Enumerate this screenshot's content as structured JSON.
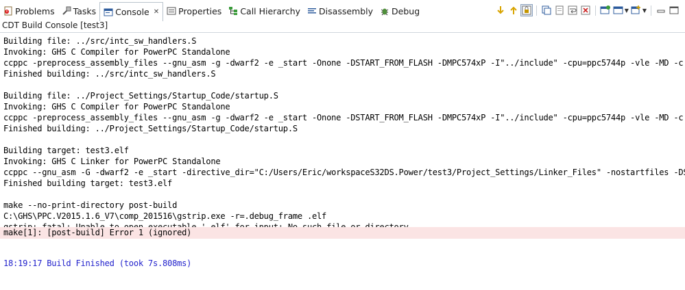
{
  "tabs": [
    {
      "id": "problems",
      "label": "Problems",
      "icon": "problems-icon",
      "active": false
    },
    {
      "id": "tasks",
      "label": "Tasks",
      "icon": "tasks-icon",
      "active": false
    },
    {
      "id": "console",
      "label": "Console",
      "icon": "console-icon",
      "active": true,
      "close": "✕"
    },
    {
      "id": "properties",
      "label": "Properties",
      "icon": "properties-icon",
      "active": false
    },
    {
      "id": "call-hierarchy",
      "label": "Call Hierarchy",
      "icon": "call-hierarchy-icon",
      "active": false
    },
    {
      "id": "disassembly",
      "label": "Disassembly",
      "icon": "disassembly-icon",
      "active": false
    },
    {
      "id": "debug",
      "label": "Debug",
      "icon": "debug-icon",
      "active": false
    }
  ],
  "toolbar_icons": [
    "scroll-down-icon",
    "scroll-up-icon",
    "scroll-lock-icon",
    "copy-icon",
    "clear-icon",
    "word-wrap-icon",
    "remove-icon",
    "pin-console-icon",
    "display-console-icon",
    "open-console-icon",
    "minimize-icon",
    "maximize-icon"
  ],
  "console_title": "CDT Build Console [test3]",
  "console_lines": [
    "Building file: ../src/intc_sw_handlers.S",
    "Invoking: GHS C Compiler for PowerPC Standalone",
    "ccppc -preprocess_assembly_files --gnu_asm -g -dwarf2 -e _start -Onone -DSTART_FROM_FLASH -DMPC574xP -I\"../include\" -cpu=ppc5744p -vle -MD -c -o",
    "Finished building: ../src/intc_sw_handlers.S",
    "",
    "Building file: ../Project_Settings/Startup_Code/startup.S",
    "Invoking: GHS C Compiler for PowerPC Standalone",
    "ccppc -preprocess_assembly_files --gnu_asm -g -dwarf2 -e _start -Onone -DSTART_FROM_FLASH -DMPC574xP -I\"../include\" -cpu=ppc5744p -vle -MD -c -o",
    "Finished building: ../Project_Settings/Startup_Code/startup.S",
    "",
    "Building target: test3.elf",
    "Invoking: GHS C Linker for PowerPC Standalone",
    "ccppc --gnu_asm -G -dwarf2 -e _start -directive_dir=\"C:/Users/Eric/workspaceS32DS.Power/test3/Project_Settings/Linker_Files\" -nostartfiles -DSTA",
    "Finished building target: test3.elf",
    "",
    "make --no-print-directory post-build",
    "C:\\GHS\\PPC.V2015.1.6_V7\\comp_201516\\gstrip.exe -r=.debug_frame .elf",
    "gstrip: fatal: Unable to open executable '.elf' for input: No such file or directory",
    "make[1]: [post-build] Error 1 (ignored)",
    "",
    "",
    "18:19:17 Build Finished (took 7s.808ms)"
  ],
  "colors": {
    "error_bg": "#fbe4e4",
    "finished_text": "#2222cc",
    "accent": "#8ca2bd"
  }
}
